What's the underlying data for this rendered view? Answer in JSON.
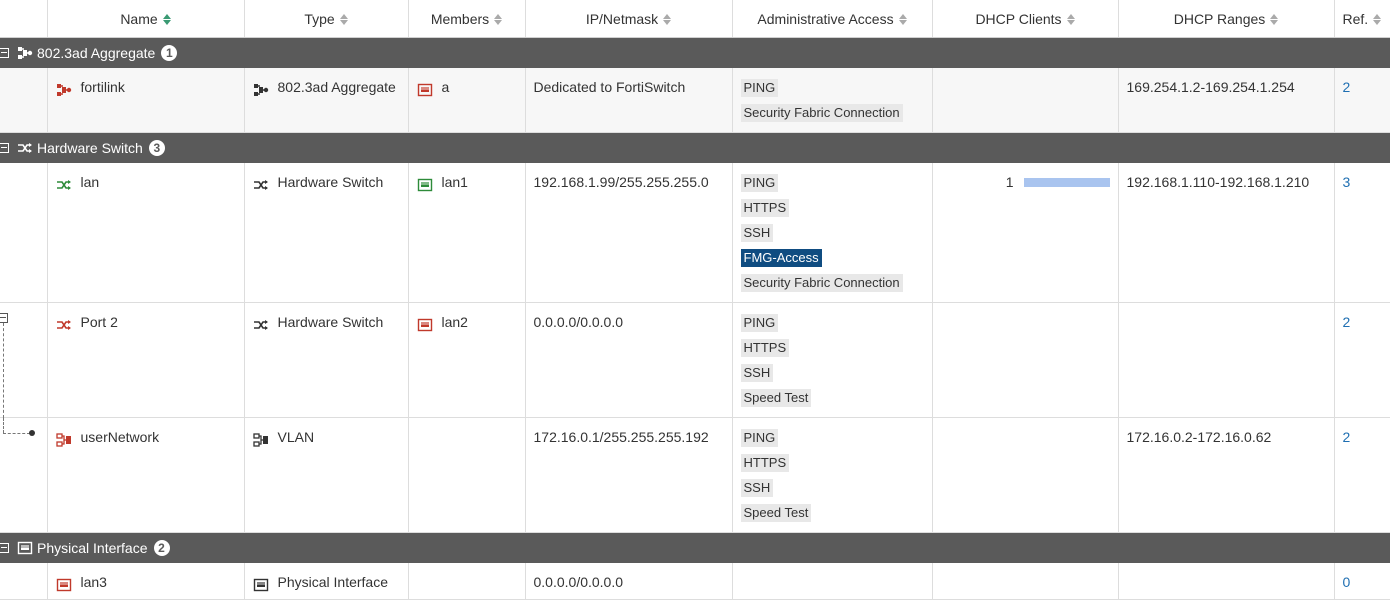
{
  "columns": [
    {
      "label": "Name",
      "sort": "active"
    },
    {
      "label": "Type",
      "sort": "none"
    },
    {
      "label": "Members",
      "sort": "none"
    },
    {
      "label": "IP/Netmask",
      "sort": "none"
    },
    {
      "label": "Administrative Access",
      "sort": "none"
    },
    {
      "label": "DHCP Clients",
      "sort": "none"
    },
    {
      "label": "DHCP Ranges",
      "sort": "none"
    },
    {
      "label": "Ref.",
      "sort": "none"
    }
  ],
  "groups": [
    {
      "title": "802.3ad Aggregate",
      "count": "1",
      "icon": "aggregate-icon",
      "rows": [
        {
          "name": "fortilink",
          "name_icon": "aggregate-icon",
          "icon_color": "#c0392b",
          "type": "802.3ad Aggregate",
          "type_icon": "aggregate-icon",
          "member": "a",
          "member_icon": "port-icon",
          "member_color": "#c0392b",
          "ip": "Dedicated to FortiSwitch",
          "access": [
            "PING",
            "Security Fabric Connection"
          ],
          "dhcp_clients": "",
          "dhcp_range": "169.254.1.2-169.254.1.254",
          "ref": "2"
        }
      ]
    },
    {
      "title": "Hardware Switch",
      "count": "3",
      "icon": "switch-icon",
      "rows": [
        {
          "name": "lan",
          "name_icon": "switch-icon",
          "icon_color": "#2e8b3a",
          "type": "Hardware Switch",
          "type_icon": "switch-icon",
          "member": "lan1",
          "member_icon": "port-icon",
          "member_color": "#2e8b3a",
          "ip": "192.168.1.99/255.255.255.0",
          "access": [
            "PING",
            "HTTPS",
            "SSH",
            "FMG-Access",
            "Security Fabric Connection"
          ],
          "access_selected": "FMG-Access",
          "dhcp_clients": "1",
          "dhcp_range": "192.168.1.110-192.168.1.210",
          "ref": "3"
        },
        {
          "name": "Port 2",
          "name_icon": "switch-icon",
          "icon_color": "#c0392b",
          "type": "Hardware Switch",
          "type_icon": "switch-icon",
          "member": "lan2",
          "member_icon": "port-icon",
          "member_color": "#c0392b",
          "ip": "0.0.0.0/0.0.0.0",
          "access": [
            "PING",
            "HTTPS",
            "SSH",
            "Speed Test"
          ],
          "dhcp_clients": "",
          "dhcp_range": "",
          "ref": "2"
        },
        {
          "name": "userNetwork",
          "name_icon": "vlan-icon",
          "icon_color": "#c0392b",
          "type": "VLAN",
          "type_icon": "vlan-icon",
          "member": "",
          "member_icon": "",
          "member_color": "",
          "ip": "172.16.0.1/255.255.255.192",
          "access": [
            "PING",
            "HTTPS",
            "SSH",
            "Speed Test"
          ],
          "dhcp_clients": "",
          "dhcp_range": "172.16.0.2-172.16.0.62",
          "ref": "2"
        }
      ]
    },
    {
      "title": "Physical Interface",
      "count": "2",
      "icon": "port-icon",
      "rows": [
        {
          "name": "lan3",
          "name_icon": "port-icon",
          "icon_color": "#c0392b",
          "type": "Physical Interface",
          "type_icon": "port-icon",
          "member": "",
          "member_icon": "",
          "member_color": "",
          "ip": "0.0.0.0/0.0.0.0",
          "access": [],
          "dhcp_clients": "",
          "dhcp_range": "",
          "ref": "0"
        }
      ]
    }
  ]
}
